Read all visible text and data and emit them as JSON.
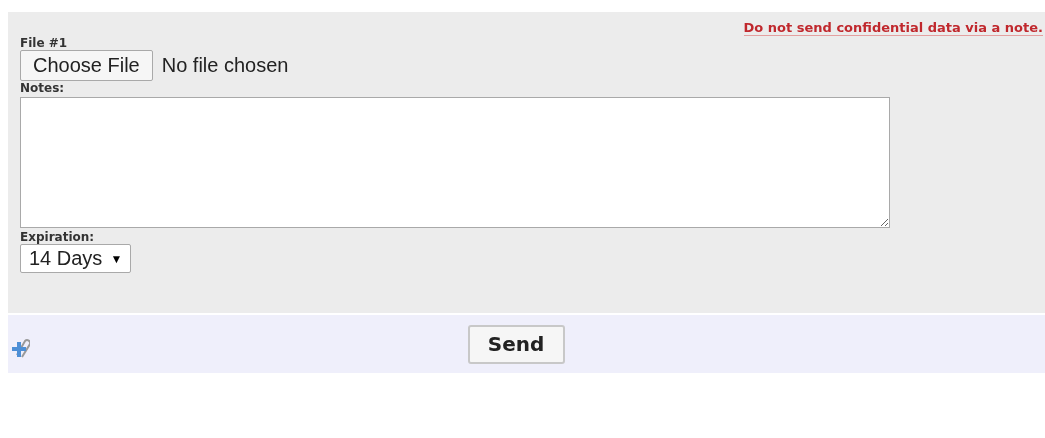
{
  "warning": "Do not send confidential data via a note.",
  "file": {
    "label": "File #1",
    "button": "Choose File",
    "status": "No file chosen"
  },
  "notes": {
    "label": "Notes:"
  },
  "expiration": {
    "label": "Expiration:",
    "value": "14 Days",
    "arrow": "▼"
  },
  "footer": {
    "send": "Send"
  }
}
